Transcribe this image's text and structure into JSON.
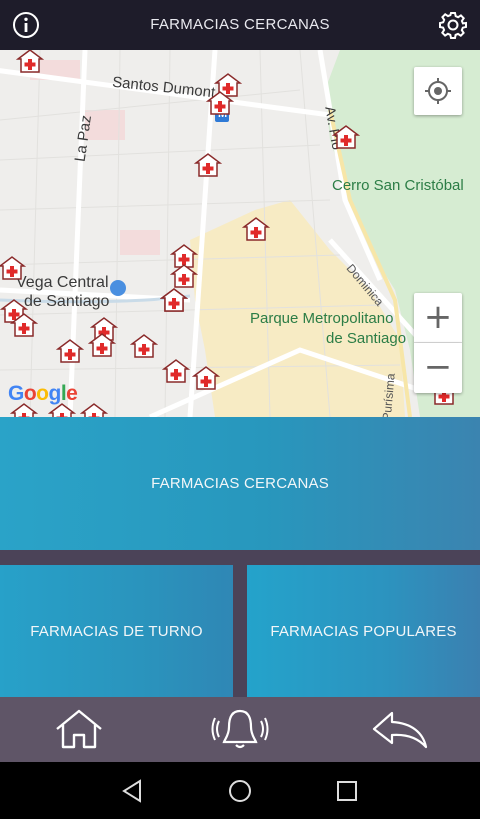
{
  "header": {
    "title": "FARMACIAS CERCANAS",
    "info_icon": "info-icon",
    "settings_icon": "gear-icon"
  },
  "map": {
    "labels": {
      "santos_dumont": "Santos Dumont",
      "la_paz": "La Paz",
      "av_pio": "Av. Pío",
      "cerro": "Cerro San Cristóbal",
      "vega_1": "Vega Central",
      "vega_2": "de Santiago",
      "parque_1": "Parque Metropolitano",
      "parque_2": "de Santiago",
      "dominica": "Dominica",
      "purisima": "Purísima",
      "metro": "M"
    },
    "attribution": "Google",
    "controls": {
      "locate_icon": "crosshair-icon",
      "zoom_in": "+",
      "zoom_out": "−"
    },
    "pharmacy_marker_icon": "pharmacy-marker-icon",
    "colors": {
      "park": "#d6ecd2",
      "zone": "#f7ebc4",
      "road": "#ffffff",
      "base": "#efeeec"
    }
  },
  "buttons": {
    "nearby": "FARMACIAS CERCANAS",
    "on_duty": "FARMACIAS DE TURNO",
    "popular": "FARMACIAS POPULARES"
  },
  "bottom_nav": {
    "home_icon": "home-icon",
    "alert_icon": "bell-icon",
    "back_icon": "back-arrow-icon"
  },
  "system_nav": {
    "back_icon": "triangle-back-icon",
    "home_icon": "circle-home-icon",
    "recents_icon": "square-recents-icon"
  },
  "colors": {
    "topbar": "#1e1c2a",
    "panel": "#2897bd",
    "divider": "#4b4358",
    "bottombar": "#5f5567"
  }
}
